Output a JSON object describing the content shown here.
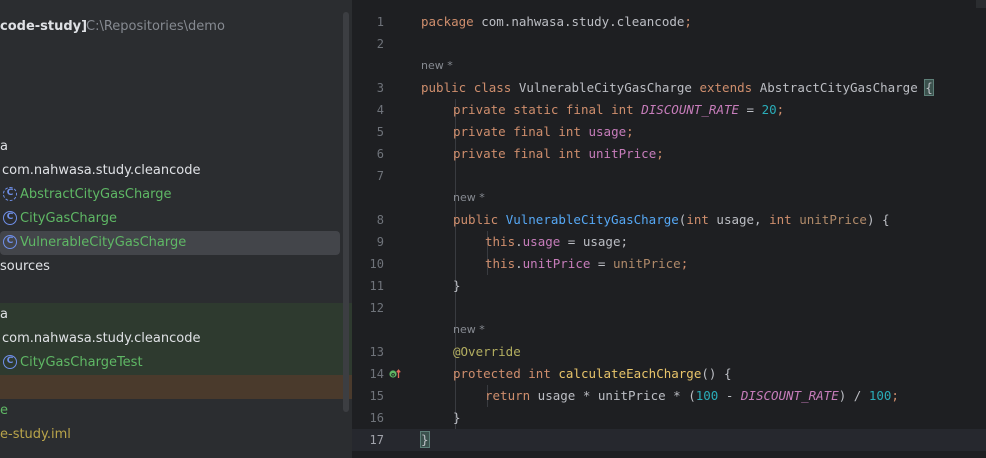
{
  "project": {
    "root_label": "code-study]",
    "root_path": "C:\\Repositories\\demo",
    "tree": [
      {
        "label": "a"
      },
      {
        "label": "com.nahwasa.study.cleancode"
      },
      {
        "label": "AbstractCityGasCharge",
        "icon": "abstract-class-icon"
      },
      {
        "label": "CityGasCharge",
        "icon": "class-icon"
      },
      {
        "label": "VulnerableCityGasCharge",
        "icon": "class-icon",
        "selected": true
      },
      {
        "label": "sources"
      },
      {
        "label": "a"
      },
      {
        "label": "com.nahwasa.study.cleancode"
      },
      {
        "label": "CityGasChargeTest",
        "icon": "class-icon"
      },
      {
        "label": "e"
      },
      {
        "label": "e-study.iml"
      }
    ]
  },
  "editor": {
    "hint_text": "new *",
    "current_line": "17",
    "line_numbers": [
      "1",
      "2",
      "3",
      "4",
      "5",
      "6",
      "7",
      "8",
      "9",
      "10",
      "11",
      "12",
      "13",
      "14",
      "15",
      "16",
      "17"
    ],
    "code": {
      "l1": [
        "package",
        " com.nahwasa.study.cleancode",
        ";"
      ],
      "l3": [
        "public",
        " ",
        "class",
        " VulnerableCityGasCharge ",
        "extends",
        " AbstractCityGasCharge ",
        "{"
      ],
      "l4": [
        "private",
        " ",
        "static",
        " ",
        "final",
        " ",
        "int",
        " ",
        "DISCOUNT_RATE",
        " = ",
        "20",
        ";"
      ],
      "l5": [
        "private",
        " ",
        "final",
        " ",
        "int",
        " ",
        "usage",
        ";"
      ],
      "l6": [
        "private",
        " ",
        "final",
        " ",
        "int",
        " ",
        "unitPrice",
        ";"
      ],
      "l8": [
        "public",
        " ",
        "VulnerableCityGasCharge",
        "(",
        "int",
        " usage, ",
        "int",
        " ",
        "unitPrice",
        ") {"
      ],
      "l9": [
        "this",
        ".",
        "usage",
        " = usage;"
      ],
      "l10": [
        "this",
        ".",
        "unitPrice",
        " = ",
        "unitPrice",
        ";"
      ],
      "l11": [
        "}"
      ],
      "l13": [
        "@Override"
      ],
      "l14": [
        "protected",
        " ",
        "int",
        " ",
        "calculateEachCharge",
        "() {"
      ],
      "l15": [
        "return",
        " usage * unitPrice * (",
        "100",
        " - ",
        "DISCOUNT_RATE",
        ") / ",
        "100",
        ";"
      ],
      "l16": [
        "}"
      ],
      "l17": [
        "}"
      ]
    }
  },
  "colors": {
    "keyword": "#cf8e6d",
    "number": "#2aacb8",
    "field": "#c77dbb",
    "method": "#56a8f5",
    "annotation": "#b3ae60",
    "comment_hint": "#868a91",
    "background": "#1e1f22",
    "sidebar_background": "#2b2d30"
  }
}
